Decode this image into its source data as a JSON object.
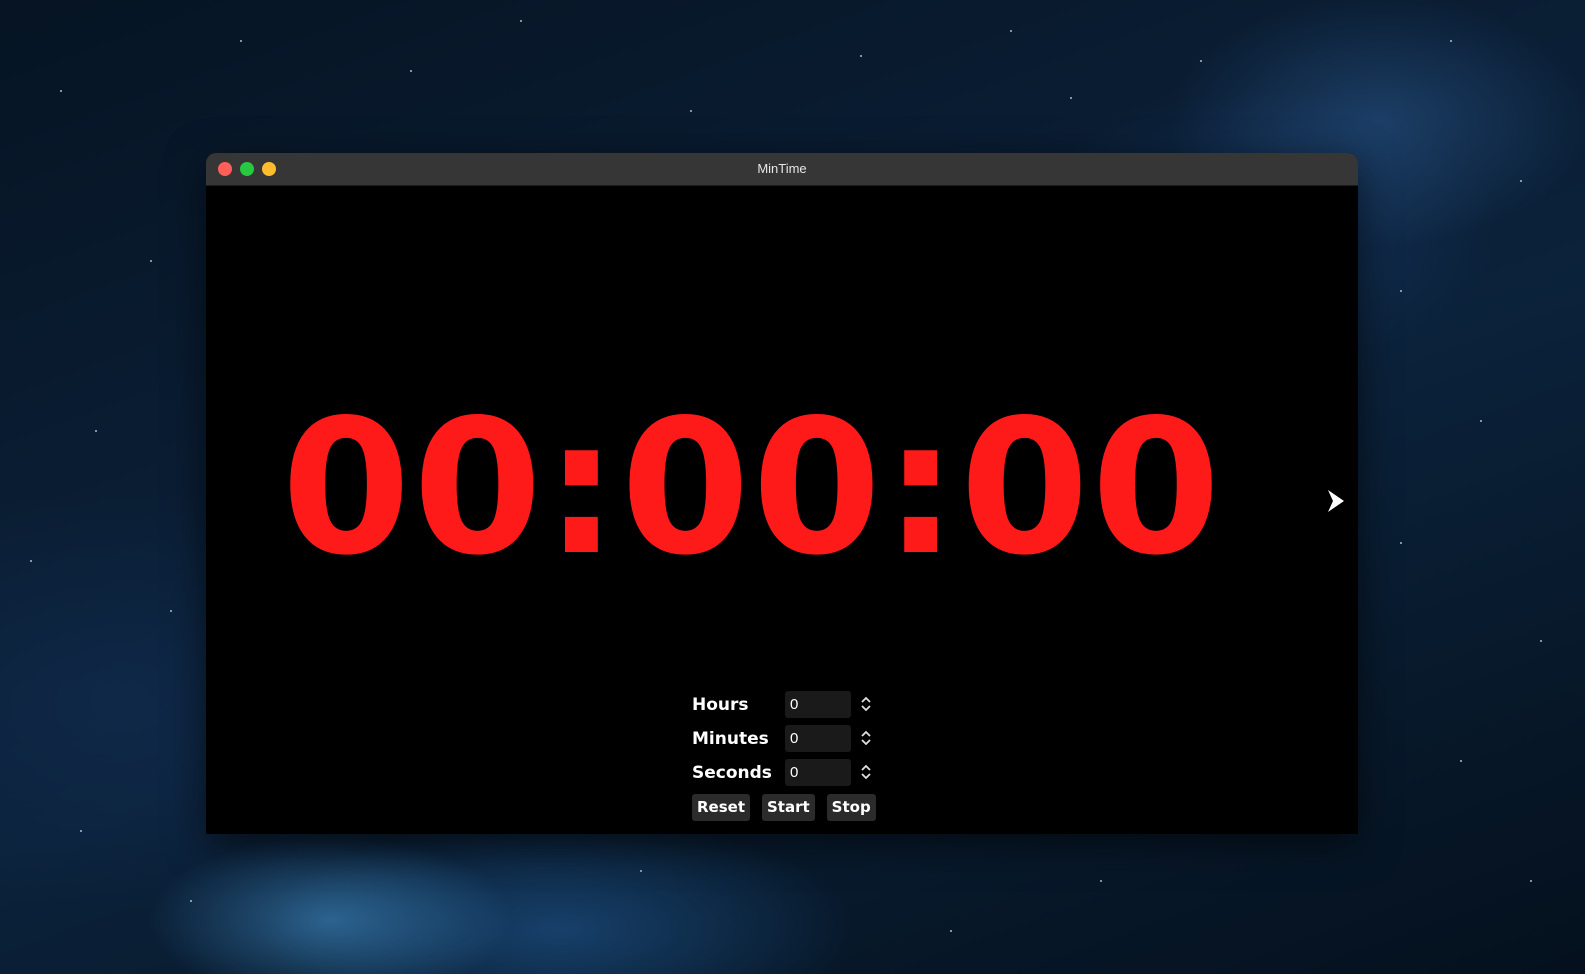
{
  "window": {
    "title": "MinTime"
  },
  "timer": {
    "display": "00:00:00",
    "color": "#ff1a1a"
  },
  "inputs": [
    {
      "label": "Hours",
      "value": "0"
    },
    {
      "label": "Minutes",
      "value": "0"
    },
    {
      "label": "Seconds",
      "value": "0"
    }
  ],
  "buttons": {
    "reset": "Reset",
    "start": "Start",
    "stop": "Stop"
  },
  "icons": {
    "next": "chevron-right-icon",
    "stepper": "up-down-chevron-icon"
  }
}
